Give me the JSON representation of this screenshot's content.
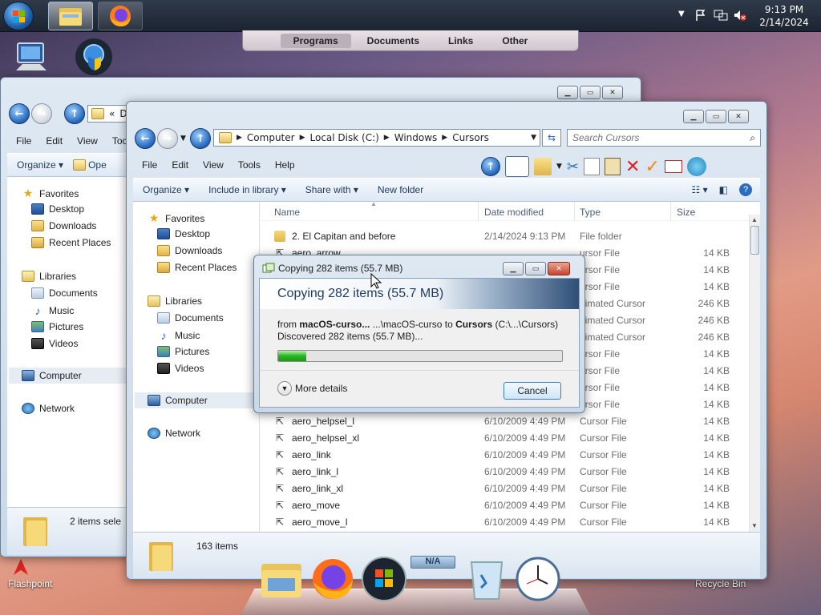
{
  "taskbar": {
    "clock_time": "9:13 PM",
    "clock_date": "2/14/2024",
    "tray_chevron": "▼"
  },
  "deskbar": {
    "items": [
      "Programs",
      "Documents",
      "Links",
      "Other"
    ]
  },
  "desktop": {
    "flashpoint_label": "Flashpoint",
    "recycle_label": "Recycle Bin"
  },
  "back_window": {
    "address_prefix": "«",
    "address_partial": "D",
    "menu": [
      "File",
      "Edit",
      "View",
      "Tools"
    ],
    "cmd_organize": "Organize",
    "cmd_open": "Ope",
    "nav": {
      "favorites": "Favorites",
      "desktop": "Desktop",
      "downloads": "Downloads",
      "recent": "Recent Places",
      "libraries": "Libraries",
      "documents": "Documents",
      "music": "Music",
      "pictures": "Pictures",
      "videos": "Videos",
      "computer": "Computer",
      "network": "Network"
    },
    "status_text": "2 items sele"
  },
  "front_window": {
    "breadcrumb": [
      "Computer",
      "Local Disk (C:)",
      "Windows",
      "Cursors"
    ],
    "search_placeholder": "Search Cursors",
    "menu": [
      "File",
      "Edit",
      "View",
      "Tools",
      "Help"
    ],
    "cmd": {
      "organize": "Organize",
      "include": "Include in library",
      "share": "Share with",
      "newfolder": "New folder"
    },
    "nav": {
      "favorites": "Favorites",
      "desktop": "Desktop",
      "downloads": "Downloads",
      "recent": "Recent Places",
      "libraries": "Libraries",
      "documents": "Documents",
      "music": "Music",
      "pictures": "Pictures",
      "videos": "Videos",
      "computer": "Computer",
      "network": "Network"
    },
    "columns": {
      "name": "Name",
      "date": "Date modified",
      "type": "Type",
      "size": "Size"
    },
    "rows": [
      {
        "name": "2. El Capitan and before",
        "date": "2/14/2024 9:13 PM",
        "type": "File folder",
        "size": ""
      },
      {
        "name": "aero_arrow",
        "date": "",
        "type": "ursor File",
        "size": "14 KB"
      },
      {
        "name": "",
        "date": "",
        "type": "ursor File",
        "size": "14 KB"
      },
      {
        "name": "",
        "date": "",
        "type": "ursor File",
        "size": "14 KB"
      },
      {
        "name": "",
        "date": "",
        "type": "nimated Cursor",
        "size": "246 KB"
      },
      {
        "name": "",
        "date": "",
        "type": "nimated Cursor",
        "size": "246 KB"
      },
      {
        "name": "",
        "date": "",
        "type": "nimated Cursor",
        "size": "246 KB"
      },
      {
        "name": "",
        "date": "",
        "type": "ursor File",
        "size": "14 KB"
      },
      {
        "name": "",
        "date": "",
        "type": "ursor File",
        "size": "14 KB"
      },
      {
        "name": "",
        "date": "",
        "type": "ursor File",
        "size": "14 KB"
      },
      {
        "name": "",
        "date": "",
        "type": "ursor File",
        "size": "14 KB"
      },
      {
        "name": "aero_helpsel_l",
        "date": "6/10/2009 4:49 PM",
        "type": "Cursor File",
        "size": "14 KB"
      },
      {
        "name": "aero_helpsel_xl",
        "date": "6/10/2009 4:49 PM",
        "type": "Cursor File",
        "size": "14 KB"
      },
      {
        "name": "aero_link",
        "date": "6/10/2009 4:49 PM",
        "type": "Cursor File",
        "size": "14 KB"
      },
      {
        "name": "aero_link_l",
        "date": "6/10/2009 4:49 PM",
        "type": "Cursor File",
        "size": "14 KB"
      },
      {
        "name": "aero_link_xl",
        "date": "6/10/2009 4:49 PM",
        "type": "Cursor File",
        "size": "14 KB"
      },
      {
        "name": "aero_move",
        "date": "6/10/2009 4:49 PM",
        "type": "Cursor File",
        "size": "14 KB"
      },
      {
        "name": "aero_move_l",
        "date": "6/10/2009 4:49 PM",
        "type": "Cursor File",
        "size": "14 KB"
      }
    ],
    "status_text": "163 items"
  },
  "copy_dialog": {
    "title": "Copying 282 items (55.7 MB)",
    "heading": "Copying 282 items (55.7 MB)",
    "from_label": "from",
    "from_name": "macOS-curso...",
    "from_path": " ...\\macOS-curso",
    "to_label": "to",
    "to_name": "Cursors",
    "to_path": "(C:\\...\\Cursors)",
    "discovered": "Discovered 282 items (55.7 MB)...",
    "progress_fraction": 0.1,
    "more_details": "More details",
    "cancel": "Cancel"
  },
  "dock": {
    "badge": "N/A"
  }
}
